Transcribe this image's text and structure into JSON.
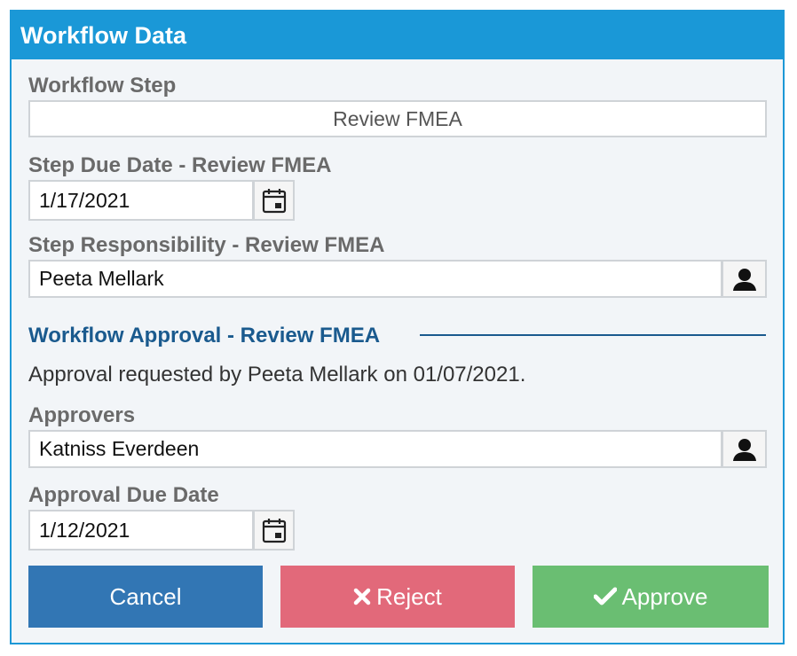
{
  "panel": {
    "title": "Workflow Data"
  },
  "workflow_step": {
    "label": "Workflow Step",
    "value": "Review FMEA"
  },
  "step_due_date": {
    "label": "Step Due Date - Review FMEA",
    "value": "1/17/2021",
    "icon": "calendar-icon"
  },
  "step_responsibility": {
    "label": "Step Responsibility - Review FMEA",
    "value": "Peeta Mellark",
    "icon": "person-icon"
  },
  "approval_section": {
    "title": "Workflow Approval - Review FMEA",
    "info": "Approval requested by Peeta Mellark on 01/07/2021."
  },
  "approvers": {
    "label": "Approvers",
    "value": "Katniss Everdeen",
    "icon": "person-icon"
  },
  "approval_due_date": {
    "label": "Approval Due Date",
    "value": "1/12/2021",
    "icon": "calendar-icon"
  },
  "buttons": {
    "cancel": "Cancel",
    "reject": "Reject",
    "approve": "Approve"
  },
  "colors": {
    "header": "#1a98d7",
    "section_title": "#1a5a8e",
    "cancel": "#3276b4",
    "reject": "#e2697a",
    "approve": "#6abe72"
  }
}
